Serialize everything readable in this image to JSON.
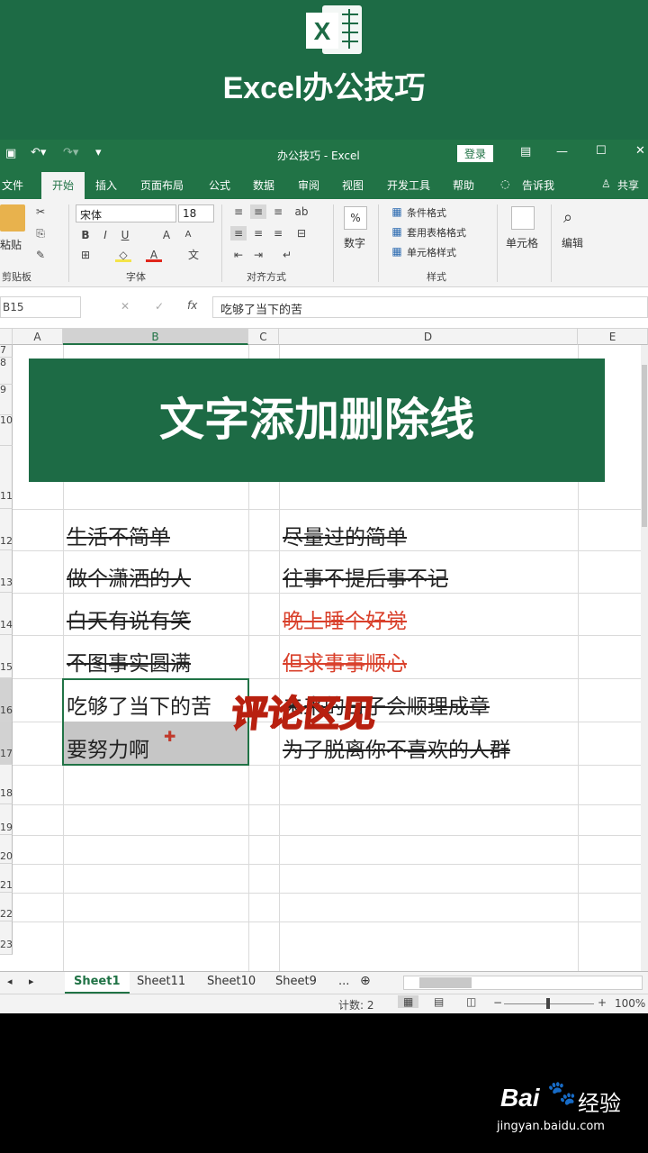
{
  "banner": {
    "title": "Excel办公技巧",
    "logo_letter": "X"
  },
  "titlebar": {
    "doc_title": "办公技巧 - Excel",
    "login_label": "登录"
  },
  "tabs": [
    "文件",
    "开始",
    "插入",
    "页面布局",
    "公式",
    "数据",
    "审阅",
    "视图",
    "开发工具",
    "帮助"
  ],
  "tell_me": "告诉我",
  "share": "共享",
  "ribbon": {
    "paste": "粘贴",
    "clipboard": "剪贴板",
    "font_name": "宋体",
    "font_size": "18",
    "font_group": "字体",
    "align_group": "对齐方式",
    "number_label": "数字",
    "number_icon": "%",
    "cond_format": "条件格式",
    "table_format": "套用表格格式",
    "cell_style": "单元格样式",
    "styles_group": "样式",
    "cells_label": "单元格",
    "edit_label": "编辑"
  },
  "formula": {
    "name_box": "B15",
    "content": "吃够了当下的苦"
  },
  "columns": [
    "A",
    "B",
    "C",
    "D",
    "E"
  ],
  "rows": [
    "7",
    "8",
    "9",
    "10",
    "11",
    "12",
    "13",
    "14",
    "15",
    "16",
    "17",
    "18",
    "19",
    "20",
    "21",
    "22",
    "23"
  ],
  "headline": "文字添加删除线",
  "cells": [
    {
      "b": "生活不简单",
      "d": "尽量过的简单"
    },
    {
      "b": "做个潇洒的人",
      "d": "往事不提后事不记"
    },
    {
      "b": "白天有说有笑",
      "d": "晚上睡个好觉"
    },
    {
      "b": "不图事实圆满",
      "d": "但求事事顺心"
    },
    {
      "b": "吃够了当下的苦",
      "d": "未来的日子会顺理成章"
    },
    {
      "b": "要努力啊",
      "d": "为了脱离你不喜欢的人群"
    }
  ],
  "overlay_text": "评论区见",
  "sheets": [
    "Sheet1",
    "Sheet11",
    "Sheet10",
    "Sheet9",
    "..."
  ],
  "status": {
    "count": "计数: 2",
    "zoom": "100%"
  },
  "watermark": {
    "brand": "Bai",
    "brand2": "经验",
    "url": "jingyan.baidu.com"
  },
  "colors": {
    "excel_green": "#217346",
    "banner_green": "#1d6b45",
    "red_text": "#d9402b",
    "overlay_red": "#e8331e"
  }
}
